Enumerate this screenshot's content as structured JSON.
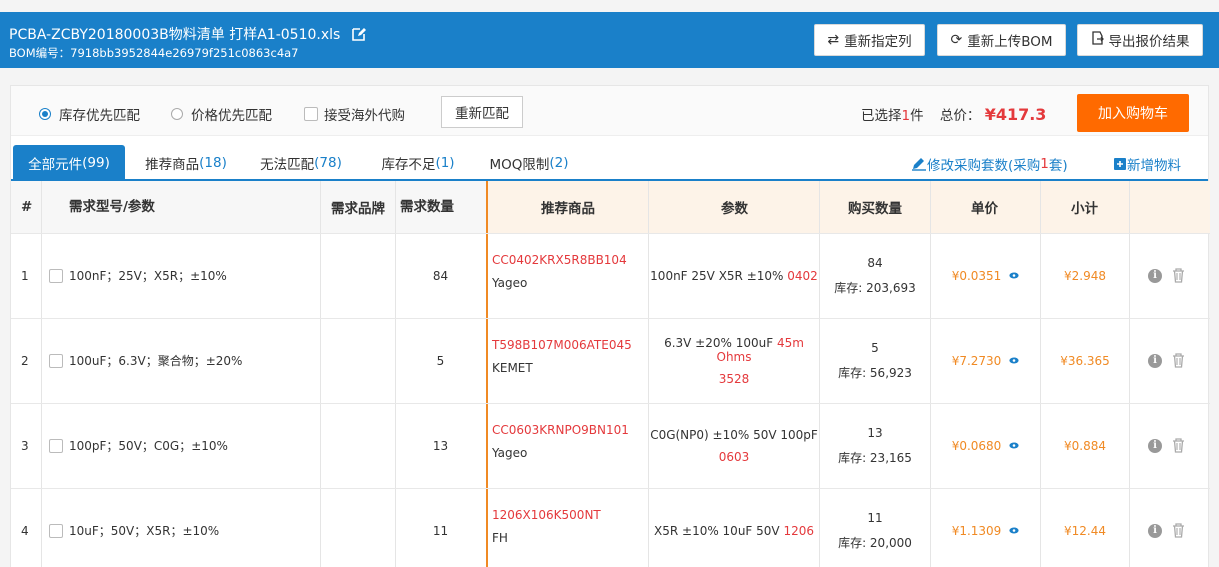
{
  "header": {
    "title": "PCBA-ZCBY20180003B物料清单 打样A1-0510.xls",
    "bom_label": "BOM编号：7918bb3952844e26979f251c0863c4a7",
    "buttons": [
      {
        "label": "重新指定列",
        "icon": "swap-icon"
      },
      {
        "label": "重新上传BOM",
        "icon": "refresh-icon"
      },
      {
        "label": "导出报价结果",
        "icon": "export-icon"
      }
    ]
  },
  "filter": {
    "options": [
      "库存优先匹配",
      "价格优先匹配"
    ],
    "selected_option": "库存优先匹配",
    "overseas_label": "接受海外代购",
    "rematch_label": "重新匹配",
    "selected_prefix": "已选择",
    "selected_count": "1",
    "selected_suffix": "件",
    "total_label": "总价：",
    "total_price": "¥417.3",
    "cart_label": "加入购物车"
  },
  "tabs": [
    {
      "label": "全部元件",
      "count": "(99)"
    },
    {
      "label": "推荐商品",
      "count": "(18)"
    },
    {
      "label": "无法匹配",
      "count": "(78)"
    },
    {
      "label": "库存不足",
      "count": "(1)"
    },
    {
      "label": "MOQ限制",
      "count": "(2)"
    }
  ],
  "tab_links": {
    "modify_label": "修改采购套数(采购",
    "modify_count": "1",
    "modify_suffix": "套)",
    "add_label": "新增物料"
  },
  "columns": {
    "index": "#",
    "model": "需求型号/参数",
    "brand": "需求品牌",
    "qty": "需求数量",
    "recommend": "推荐商品",
    "params": "参数",
    "buy_qty": "购买数量",
    "unit_price": "单价",
    "subtotal": "小计"
  },
  "rows": [
    {
      "index": "1",
      "model": "100nF；25V；X5R；±10%",
      "qty": "84",
      "part": "CC0402KRX5R8BB104",
      "brand": "Yageo",
      "params": "100nF 25V X5R ±10%",
      "params_hl": "0402",
      "buy_qty": "84",
      "stock": "库存: 203,693",
      "unit_price": "¥0.0351",
      "subtotal": "¥2.948"
    },
    {
      "index": "2",
      "model": "100uF；6.3V；聚合物；±20%",
      "qty": "5",
      "part": "T598B107M006ATE045",
      "brand": "KEMET",
      "params": "6.3V ±20% 100uF",
      "params_hl": "45m Ohms",
      "params_line2": "3528",
      "buy_qty": "5",
      "stock": "库存: 56,923",
      "unit_price": "¥7.2730",
      "subtotal": "¥36.365"
    },
    {
      "index": "3",
      "model": "100pF；50V；C0G；±10%",
      "qty": "13",
      "part": "CC0603KRNPO9BN101",
      "brand": "Yageo",
      "params": "C0G(NP0) ±10% 50V 100pF",
      "params_line2": "0603",
      "buy_qty": "13",
      "stock": "库存: 23,165",
      "unit_price": "¥0.0680",
      "subtotal": "¥0.884"
    },
    {
      "index": "4",
      "model": "10uF；50V；X5R；±10%",
      "qty": "11",
      "part": "1206X106K500NT",
      "brand": "FH",
      "params": "X5R ±10% 10uF 50V",
      "params_hl": "1206",
      "buy_qty": "11",
      "stock": "库存: 20,000",
      "unit_price": "¥1.1309",
      "subtotal": "¥12.44"
    }
  ],
  "colors": {
    "primary": "#1a80c9",
    "accent": "#ff6a00",
    "price": "#f08a24",
    "highlight": "#e4393c"
  }
}
